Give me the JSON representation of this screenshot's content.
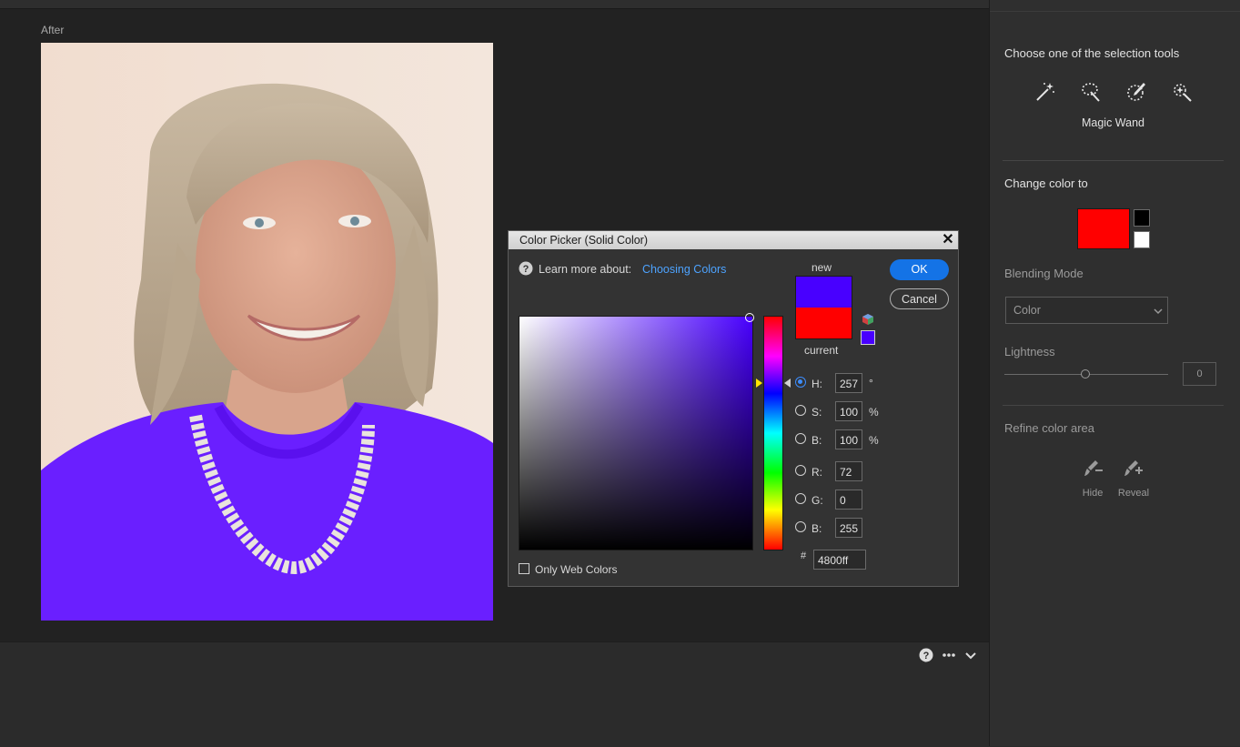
{
  "workspace": {
    "view_label": "After"
  },
  "bottom_bar": {
    "help_icon": "help-icon",
    "more_icon": "more-icon",
    "collapse_icon": "chevron-down-icon"
  },
  "right_panel": {
    "selection_heading": "Choose one of the selection tools",
    "tools": [
      {
        "name": "magic-wand-icon"
      },
      {
        "name": "lasso-icon"
      },
      {
        "name": "brush-select-icon"
      },
      {
        "name": "auto-select-icon"
      }
    ],
    "selected_tool_label": "Magic Wand",
    "change_color_heading": "Change color to",
    "change_color_swatch": "#ff0000",
    "blending_heading": "Blending Mode",
    "blending_value": "Color",
    "lightness_heading": "Lightness",
    "lightness_value": "0",
    "lightness_level": 0.5,
    "refine_heading": "Refine color area",
    "hide_label": "Hide",
    "reveal_label": "Reveal"
  },
  "color_picker": {
    "title": "Color Picker (Solid Color)",
    "learn_more": "Learn more about:",
    "learn_link": "Choosing Colors",
    "new_label": "new",
    "current_label": "current",
    "new_color": "#4800ff",
    "current_color": "#ff0000",
    "ok_label": "OK",
    "cancel_label": "Cancel",
    "fields": {
      "h_label": "H:",
      "h_value": "257",
      "h_unit": "°",
      "s_label": "S:",
      "s_value": "100",
      "s_unit": "%",
      "b_label": "B:",
      "b_value": "100",
      "b_unit": "%",
      "r_label": "R:",
      "r_value": "72",
      "g_label": "G:",
      "g_value": "0",
      "b2_label": "B:",
      "b2_value": "255"
    },
    "hash_label": "#",
    "hex_value": "4800ff",
    "only_web_label": "Only Web Colors"
  }
}
